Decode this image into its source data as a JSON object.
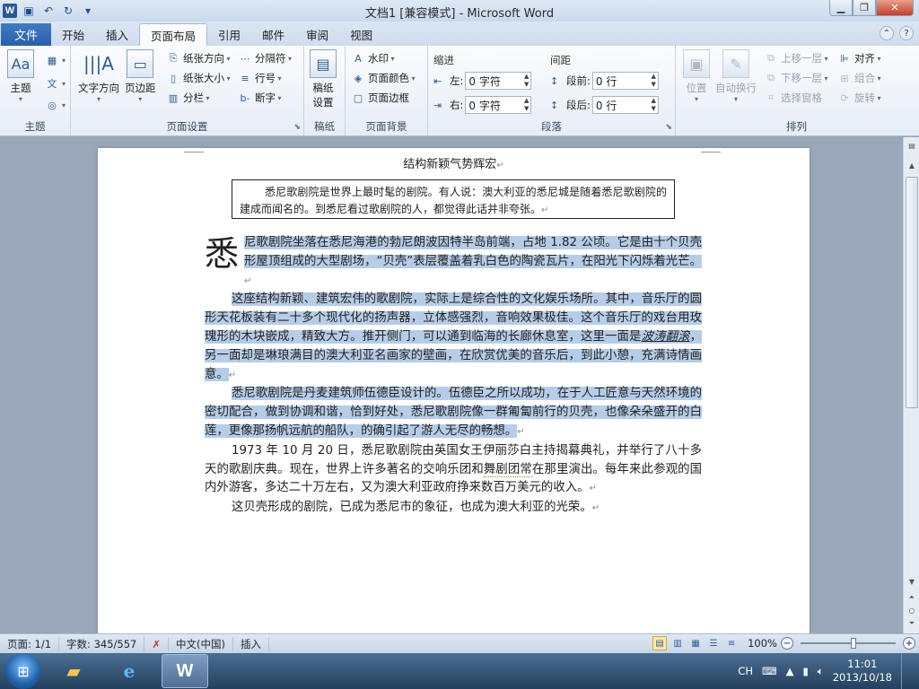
{
  "window": {
    "title": "文档1 [兼容模式] - Microsoft Word",
    "app_icon_letter": "W"
  },
  "tabs": {
    "file": "文件",
    "items": [
      "开始",
      "插入",
      "页面布局",
      "引用",
      "邮件",
      "审阅",
      "视图"
    ],
    "active": "页面布局"
  },
  "ribbon": {
    "theme": {
      "label": "主题",
      "btn": "主题",
      "colors": "",
      "fonts": "文",
      "effects": ""
    },
    "page_setup": {
      "label": "页面设置",
      "text_direction": "文字方向",
      "margins": "页边距",
      "orientation": "纸张方向",
      "size": "纸张大小",
      "columns": "分栏",
      "breaks": "分隔符",
      "line_numbers": "行号",
      "hyphenation": "断字"
    },
    "draft": {
      "label": "稿纸",
      "btn_line1": "稿纸",
      "btn_line2": "设置"
    },
    "page_background": {
      "label": "页面背景",
      "watermark": "水印",
      "page_color": "页面颜色",
      "page_border": "页面边框"
    },
    "paragraph": {
      "label": "段落",
      "indent": "缩进",
      "spacing": "间距",
      "left": "左:",
      "right": "右:",
      "before": "段前:",
      "after": "段后:",
      "left_value": "0 字符",
      "right_value": "0 字符",
      "before_value": "0 行",
      "after_value": "0 行"
    },
    "arrange": {
      "label": "排列",
      "position": "位置",
      "wrap": "自动换行",
      "bring_forward": "上移一层",
      "send_backward": "下移一层",
      "selection_pane": "选择窗格",
      "align": "对齐",
      "group": "组合",
      "rotate": "旋转"
    }
  },
  "document": {
    "title": "结构新颖气势辉宏",
    "quote": "悉尼歌剧院是世界上最时髦的剧院。有人说：澳大利亚的悉尼城是随着悉尼歌剧院的建成而闻名的。到悉尼看过歌剧院的人，都觉得此话并非夸张。",
    "drop_cap": "悉",
    "p1": "尼歌剧院坐落在悉尼海港的勃尼朗波因特半岛前端，占地 1.82 公顷。它是由十个贝壳形屋顶组成的大型剧场，“贝壳”表层覆盖着乳白色的陶瓷瓦片，在阳光下闪烁着光芒。",
    "p2_a": "这座结构新颖、建筑宏伟的歌剧院，实际上是综合性的文化娱乐场所。其中，音乐厅的圆形天花板装有二十多个现代化的扬声器，立体感强烈，音响效果极佳。这个音乐厅的戏台用玫瑰形的木块嵌成，精致大方。推开侧门，可以通到临海的长廊休息室，这里一面是",
    "p2_ital": "波涛翻滚",
    "p2_b": "，另一面却是琳琅满目的澳大利亚名画家的壁画，在欣赏优美的音乐后，到此小憩，充满诗情画意。",
    "p3": "悉尼歌剧院是丹麦建筑师伍德臣设计的。伍德臣之所以成功，在于人工匠意与天然环境的密切配合，做到协调和谐，恰到好处，悉尼歌剧院像一群匍匐前行的贝壳，也像朵朵盛开的白莲，更像那扬帆远航的船队，的确引起了游人无尽的畅想。",
    "p4_a": "1973 年 10 月 20 日，悉尼歌剧院由英国女王伊丽莎白主持揭幕典礼，并举行了八十多天的歌剧庆典。现在，世界上许多著名的交响乐团和",
    "p4_wave": "舞剧团常",
    "p4_b": "在那里演出。每年来此参观的国内外游客，多达二十万左右，又为澳大利亚政府挣来数百万美元的收入。",
    "p5": "这贝壳形成的剧院，已成为悉尼市的象征，也成为澳大利亚的光荣。",
    "para_mark": "↵"
  },
  "status": {
    "page": "页面: 1/1",
    "words": "字数: 345/557",
    "language": "中文(中国)",
    "mode": "插入",
    "zoom": "100%"
  },
  "taskbar": {
    "ime": "CH",
    "time": "11:01",
    "date": "2013/10/18"
  },
  "colors": {
    "selection": "#b6cde8",
    "file_tab": "#2a5ea8",
    "accent": "#2f5c93"
  }
}
